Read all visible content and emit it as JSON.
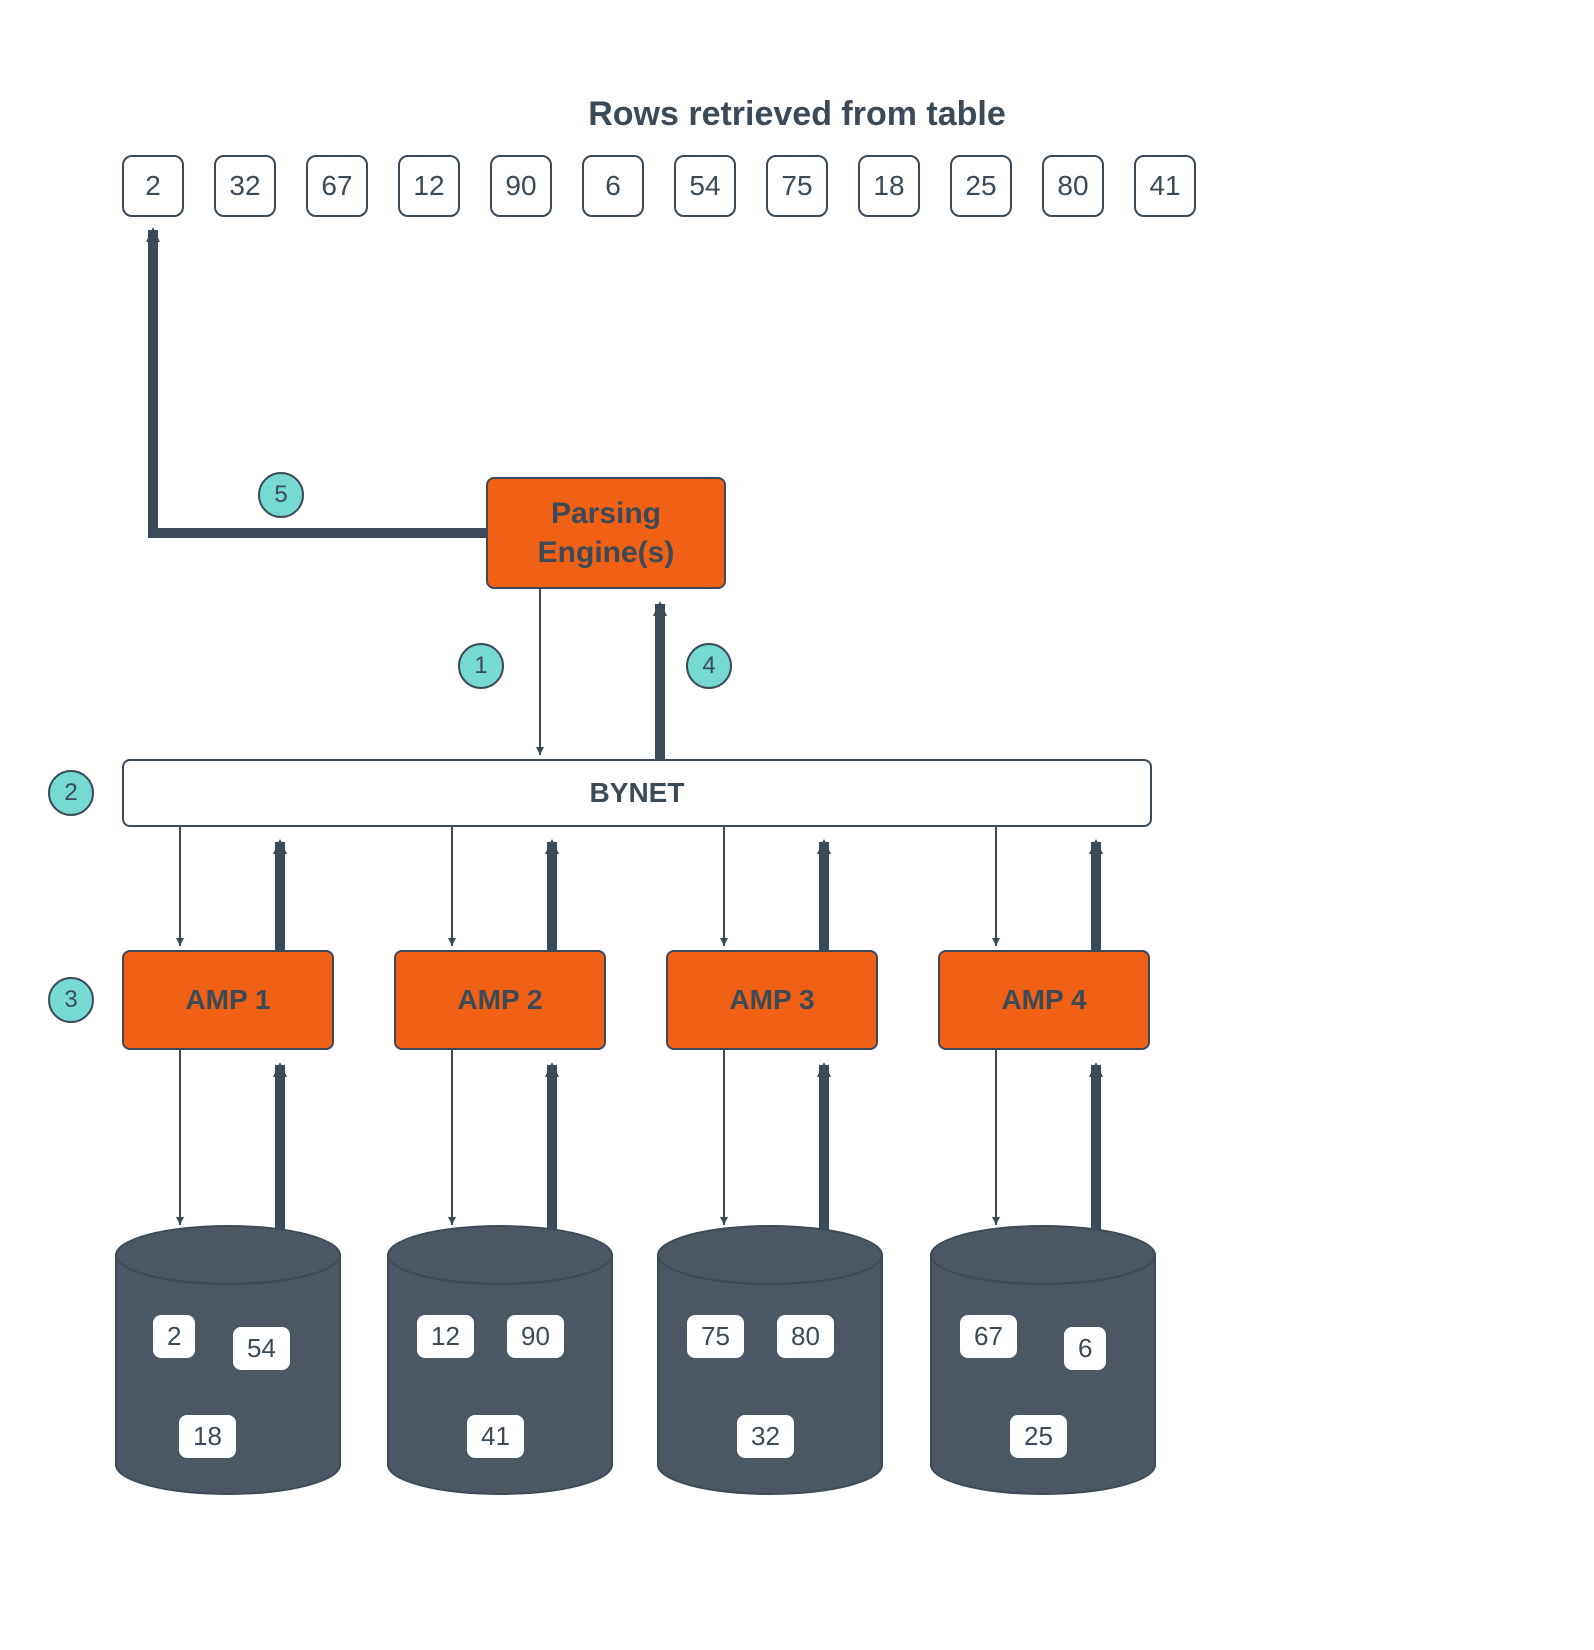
{
  "title": "Rows retrieved from table",
  "rows": [
    "2",
    "32",
    "67",
    "12",
    "90",
    "6",
    "54",
    "75",
    "18",
    "25",
    "80",
    "41"
  ],
  "pe_label": "Parsing\nEngine(s)",
  "bynet_label": "BYNET",
  "steps": {
    "s1": "1",
    "s2": "2",
    "s3": "3",
    "s4": "4",
    "s5": "5"
  },
  "amps": [
    {
      "label": "AMP 1",
      "vals": [
        "2",
        "54",
        "18"
      ]
    },
    {
      "label": "AMP 2",
      "vals": [
        "12",
        "90",
        "41"
      ]
    },
    {
      "label": "AMP 3",
      "vals": [
        "75",
        "80",
        "32"
      ]
    },
    {
      "label": "AMP 4",
      "vals": [
        "67",
        "6",
        "25"
      ]
    }
  ]
}
